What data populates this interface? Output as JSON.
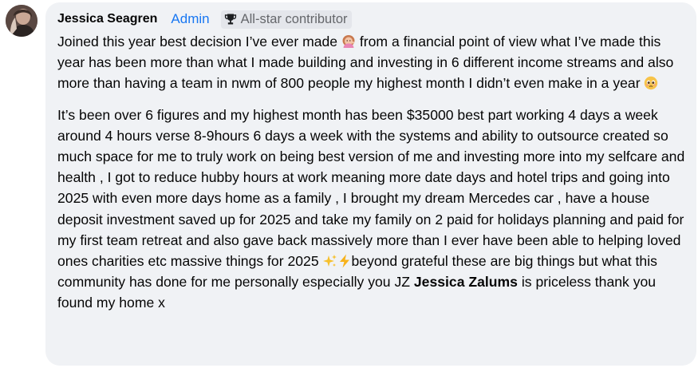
{
  "comment": {
    "author": "Jessica Seagren",
    "role_badge": "Admin",
    "contributor_badge": "All-star contributor",
    "avatar_icon": "profile-photo",
    "colors": {
      "bubble_bg": "#f0f2f5",
      "admin_blue": "#1877f2",
      "badge_bg": "#e4e6eb",
      "muted_text": "#65676b"
    },
    "paragraph1": {
      "part1": "Joined this year best decision I’ve ever made ",
      "emoji1": "woman-tipping-hand-emoji",
      "part2": " from a financial point of view what I’ve made this year has been more than what I made building and investing in 6 different income streams and also more than having a team in nwm of 800 people my highest month I didn’t even make in a year ",
      "emoji2": "pleading-face-emoji"
    },
    "paragraph2": {
      "part1": "It’s been over 6 figures and my highest month has been $35000 best part working 4 days a week around 4 hours verse 8-9hours 6 days a week with the systems and ability to outsource created so much space for me to truly work on being best version of me and investing more into my selfcare and health , I got to reduce hubby hours at work meaning more date days and hotel trips and going into 2025 with even more days home as a family , I brought my dream Mercedes car , have a house deposit investment saved up for 2025 and take my family on 2 paid for holidays planning and paid for my first team retreat and also gave back massively more than I ever have been able to helping loved ones charities etc massive things for 2025 ",
      "emoji_sparkles": "sparkles-emoji",
      "emoji_lightning": "lightning-emoji",
      "part2": "beyond grateful these are big things but what this community has done for me personally especially you JZ ",
      "mention": "Jessica Zalums",
      "part3": " is priceless thank you found my home x"
    }
  }
}
